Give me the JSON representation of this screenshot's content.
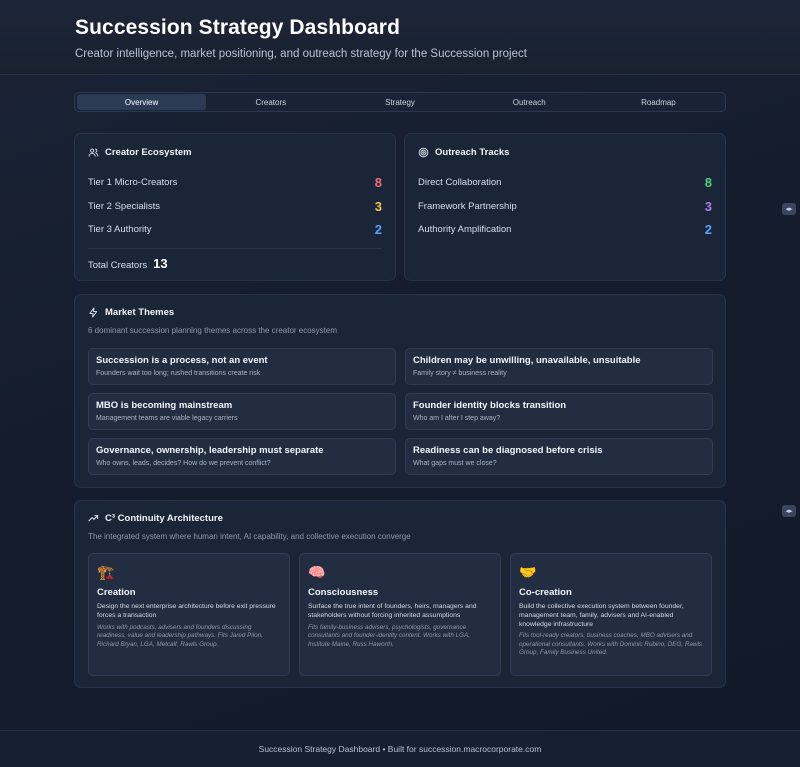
{
  "header": {
    "title": "Succession Strategy Dashboard",
    "subtitle": "Creator intelligence, market positioning, and outreach strategy for the Succession project"
  },
  "tabs": [
    {
      "label": "Overview",
      "active": true
    },
    {
      "label": "Creators",
      "active": false
    },
    {
      "label": "Strategy",
      "active": false
    },
    {
      "label": "Outreach",
      "active": false
    },
    {
      "label": "Roadmap",
      "active": false
    }
  ],
  "ecosystem": {
    "title": "Creator Ecosystem",
    "icon": "users-icon",
    "rows": [
      {
        "label": "Tier 1 Micro-Creators",
        "value": "8",
        "color": "#f36b7f"
      },
      {
        "label": "Tier 2 Specialists",
        "value": "3",
        "color": "#f5c542"
      },
      {
        "label": "Tier 3 Authority",
        "value": "2",
        "color": "#5aa2f5"
      }
    ],
    "total_label": "Total Creators",
    "total_value": "13"
  },
  "outreach": {
    "title": "Outreach Tracks",
    "icon": "target-icon",
    "rows": [
      {
        "label": "Direct Collaboration",
        "value": "8",
        "color": "#4ed17a"
      },
      {
        "label": "Framework Partnership",
        "value": "3",
        "color": "#b07cf0"
      },
      {
        "label": "Authority Amplification",
        "value": "2",
        "color": "#5aa2f5"
      }
    ]
  },
  "themes": {
    "title": "Market Themes",
    "icon": "lightning-icon",
    "subtitle": "6 dominant succession planning themes across the creator ecosystem",
    "items": [
      {
        "title": "Succession is a process, not an event",
        "desc": "Founders wait too long; rushed transitions create risk"
      },
      {
        "title": "Children may be unwilling, unavailable, unsuitable",
        "desc": "Family story ≠ business reality"
      },
      {
        "title": "MBO is becoming mainstream",
        "desc": "Management teams are viable legacy carriers"
      },
      {
        "title": "Founder identity blocks transition",
        "desc": "Who am I after I step away?"
      },
      {
        "title": "Governance, ownership, leadership must separate",
        "desc": "Who owns, leads, decides? How do we prevent conflict?"
      },
      {
        "title": "Readiness can be diagnosed before crisis",
        "desc": "What gaps must we close?"
      }
    ]
  },
  "architecture": {
    "title": "C³ Continuity Architecture",
    "icon": "trend-up-icon",
    "subtitle": "The integrated system where human intent, AI capability, and collective execution converge",
    "pillars": [
      {
        "emoji": "🏗️",
        "icon": "construction-icon",
        "name": "Creation",
        "desc": "Design the next enterprise architecture before exit pressure forces a transaction",
        "note": "Works with podcasts, advisers and founders discussing readiness, value and leadership pathways. Fits Jared Pilon, Richard Bryan, LGA, Metcalf, Rawls Group."
      },
      {
        "emoji": "🧠",
        "icon": "brain-icon",
        "name": "Consciousness",
        "desc": "Surface the true intent of founders, heirs, managers and stakeholders without forcing inherited assumptions",
        "note": "Fits family-business advisers, psychologists, governance consultants and founder-identity content. Works with LGA, Institute Maine, Russ Haworth."
      },
      {
        "emoji": "🤝",
        "icon": "handshake-icon",
        "name": "Co-creation",
        "desc": "Build the collective execution system between founder, management team, family, advisers and AI-enabled knowledge infrastructure",
        "note": "Fits tool-ready creators, business coaches, MBO advisers and operational consultants. Works with Dominic Rubino, DEG, Rawls Group, Family Business United."
      }
    ]
  },
  "footer": {
    "text": "Succession Strategy Dashboard • Built for succession.macrocorporate.com"
  }
}
